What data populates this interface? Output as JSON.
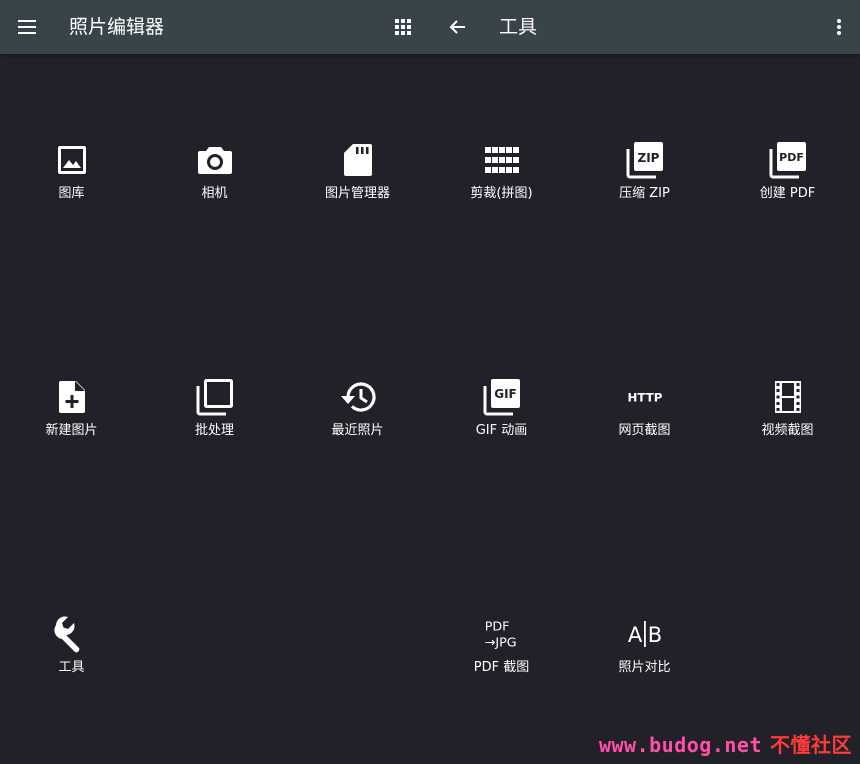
{
  "appbar": {
    "title": "照片编辑器",
    "tool_title": "工具",
    "icons": {
      "menu": "hamburger-menu-icon",
      "apps": "apps-grid-icon",
      "back": "arrow-back-icon",
      "more": "more-vert-icon"
    }
  },
  "tiles": [
    {
      "label": "图库",
      "icon": "image-icon"
    },
    {
      "label": "相机",
      "icon": "camera-icon"
    },
    {
      "label": "图片管理器",
      "icon": "sd-card-icon"
    },
    {
      "label": "剪裁(拼图)",
      "icon": "grid-icon"
    },
    {
      "label": "压缩 ZIP",
      "icon": "zip-icon",
      "icon_text": "ZIP"
    },
    {
      "label": "创建 PDF",
      "icon": "pdf-icon",
      "icon_text": "PDF"
    },
    {
      "label": "新建图片",
      "icon": "new-file-icon"
    },
    {
      "label": "批处理",
      "icon": "batch-icon"
    },
    {
      "label": "最近照片",
      "icon": "history-icon"
    },
    {
      "label": "GIF 动画",
      "icon": "gif-icon",
      "icon_text": "GIF"
    },
    {
      "label": "网页截图",
      "icon": "http-icon",
      "icon_text": "HTTP"
    },
    {
      "label": "视频截图",
      "icon": "film-icon"
    },
    {
      "label": "工具",
      "icon": "wrench-icon"
    },
    {
      "label": "PDF 截图",
      "icon": "pdf-to-jpg-icon",
      "icon_text_line1": "PDF",
      "icon_text_line2": "→JPG"
    },
    {
      "label": "照片对比",
      "icon": "compare-icon",
      "icon_text_a": "A",
      "icon_text_b": "B"
    }
  ],
  "watermark": {
    "site": "www.budog.net",
    "brand": "不懂社区"
  }
}
